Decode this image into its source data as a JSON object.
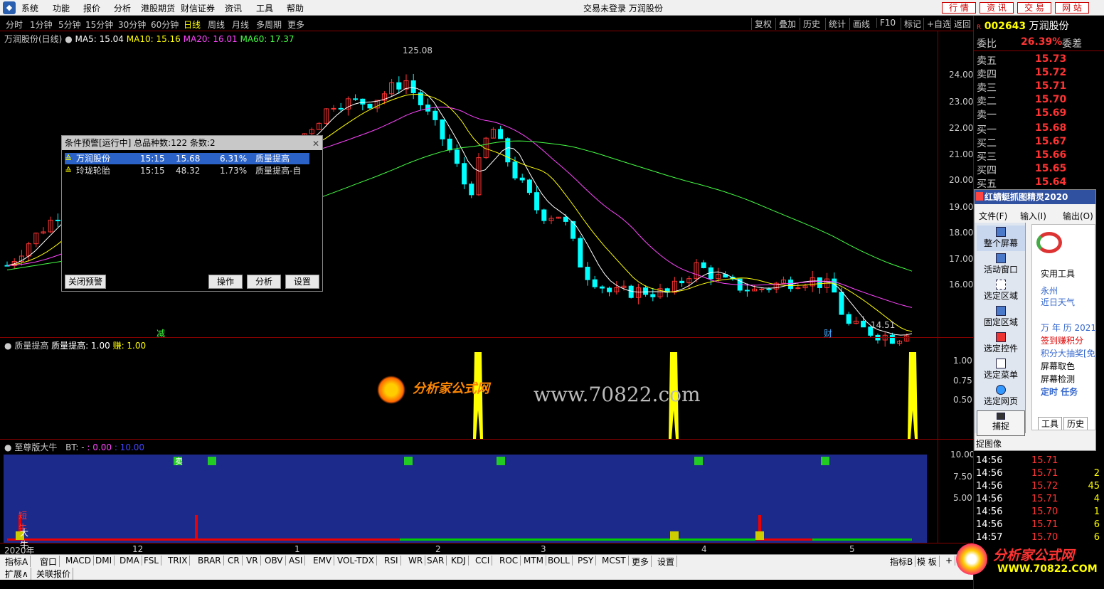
{
  "menubar": {
    "items": [
      "系统",
      "功能",
      "报价",
      "分析",
      "港股期货",
      "财信证券",
      "资讯",
      "工具",
      "帮助"
    ],
    "title": "交易未登录  万润股份",
    "top_buttons": [
      "行 情",
      "资 讯",
      "交 易",
      "网 站"
    ]
  },
  "periods": {
    "items": [
      "分时",
      "1分钟",
      "5分钟",
      "15分钟",
      "30分钟",
      "60分钟",
      "日线",
      "周线",
      "月线",
      "多周期",
      "更多"
    ],
    "active": "日线",
    "right_buttons": [
      "复权",
      "叠加",
      "历史",
      "统计",
      "画线",
      "F10",
      "标记",
      "+自选",
      "返回"
    ]
  },
  "kline_info": {
    "name": "万润股份(日线)",
    "ma5": "MA5: 15.04",
    "ma10": "MA10: 15.16",
    "ma20": "MA20: 16.01",
    "ma60": "MA60: 17.37",
    "high_mark": "125.08",
    "low_mark": "14.51",
    "marker_jian": "减",
    "marker_cai": "财"
  },
  "price_axis": [
    "24.00",
    "23.00",
    "22.00",
    "21.00",
    "20.00",
    "19.00",
    "18.00",
    "17.00",
    "16.00"
  ],
  "indicator1": {
    "title": "质量提高",
    "label": "质量提高: 1.00",
    "label2": "赚: 1.00",
    "axis": [
      "1.00",
      "0.75",
      "0.50"
    ],
    "spikes": [
      3
    ]
  },
  "indicator2": {
    "title": "至尊版大牛",
    "bt": "BT: -",
    "v1": ": 0.00",
    "v2": ": 10.00",
    "axis": [
      "10.00",
      "7.50",
      "5.00"
    ],
    "sell_label": "卖",
    "hold_label": "短牛",
    "bull_label": "大牛"
  },
  "time_axis": [
    "2020年",
    "12",
    "1",
    "2",
    "3",
    "4",
    "5"
  ],
  "alert": {
    "header": "条件预警[运行中] 总品种数:122 条数:2",
    "rows": [
      {
        "name": "万润股份",
        "time": "15:15",
        "price": "15.68",
        "pct": "6.31%",
        "cond": "质量提高"
      },
      {
        "name": "玲珑轮胎",
        "time": "15:15",
        "price": "48.32",
        "pct": "1.73%",
        "cond": "质量提高-自"
      }
    ],
    "buttons": [
      "关闭预警",
      "操作",
      "分析",
      "设置"
    ]
  },
  "stock": {
    "code": "002643",
    "name": "万润股份",
    "weibi_label": "委比",
    "weibi": "26.39%",
    "weicha_label": "委差",
    "orderbook": [
      {
        "label": "卖五",
        "price": "15.73"
      },
      {
        "label": "卖四",
        "price": "15.72"
      },
      {
        "label": "卖三",
        "price": "15.71"
      },
      {
        "label": "卖二",
        "price": "15.70"
      },
      {
        "label": "卖一",
        "price": "15.69"
      },
      {
        "label": "买一",
        "price": "15.68"
      },
      {
        "label": "买二",
        "price": "15.67"
      },
      {
        "label": "买三",
        "price": "15.66"
      },
      {
        "label": "买四",
        "price": "15.65"
      },
      {
        "label": "买五",
        "price": "15.64"
      }
    ]
  },
  "capture_tool": {
    "title": "红蜻蜓抓图精灵2020",
    "menu": [
      "文件(F)",
      "输入(I)",
      "输出(O)"
    ],
    "tools": [
      "整个屏幕",
      "活动窗口",
      "选定区域",
      "固定区域",
      "选定控件",
      "选定菜单",
      "选定网页",
      "捕捉"
    ],
    "side": [
      "实用工具",
      "永州",
      "近日天气",
      "万 年 历 2021",
      "签到赚积分",
      "积分大抽奖[免",
      "屏幕取色",
      "屏幕检测",
      "定时 任务"
    ],
    "bottom_tabs": [
      "工具",
      "历史"
    ],
    "status": "捉图像"
  },
  "ticks": [
    {
      "time": "14:56",
      "price": "15.71",
      "vol": ""
    },
    {
      "time": "14:56",
      "price": "15.71",
      "vol": "2"
    },
    {
      "time": "14:56",
      "price": "15.72",
      "vol": "45"
    },
    {
      "time": "14:56",
      "price": "15.71",
      "vol": "4"
    },
    {
      "time": "14:56",
      "price": "15.70",
      "vol": "1"
    },
    {
      "time": "14:56",
      "price": "15.71",
      "vol": "6"
    },
    {
      "time": "14:57",
      "price": "15.70",
      "vol": "6"
    }
  ],
  "tabs": [
    "指标A",
    "窗口",
    "MACD",
    "DMI",
    "DMA",
    "FSL",
    "TRIX",
    "BRAR",
    "CR",
    "VR",
    "OBV",
    "ASI",
    "EMV",
    "VOL-TDX",
    "RSI",
    "WR",
    "SAR",
    "KDJ",
    "CCI",
    "ROC",
    "MTM",
    "BOLL",
    "PSY",
    "MCST",
    "更多",
    "设置"
  ],
  "tabs_right": [
    "指标B",
    "模 板",
    "+"
  ],
  "ext": [
    "扩展∧",
    "关联报价"
  ],
  "watermark": {
    "text1": "分析家公式网",
    "url1": "www.70822.com",
    "text2": "分析家公式网",
    "url2": "WWW.70822.COM"
  },
  "colors": {
    "up": "#ff3333",
    "down": "#00ffff",
    "ma5": "#ffffff",
    "ma10": "#ffff00",
    "ma20": "#ff44ff",
    "ma60": "#44ff44"
  }
}
